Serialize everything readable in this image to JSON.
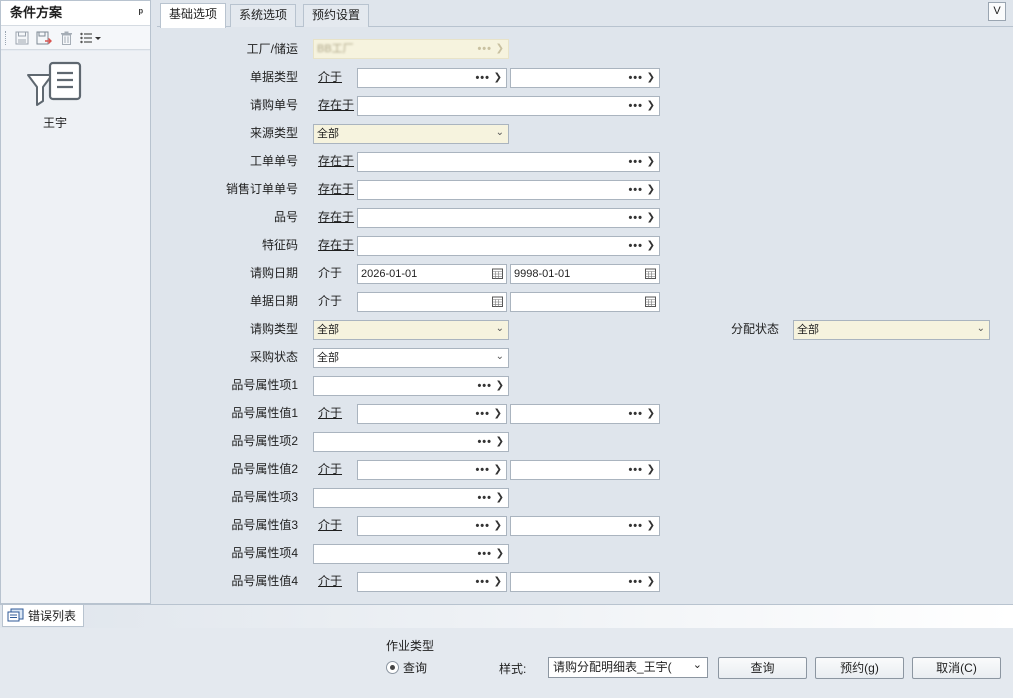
{
  "left_panel": {
    "title": "条件方案",
    "pin": "ᵖ",
    "scheme_name": "王宇"
  },
  "tabs": [
    "基础选项",
    "系统选项",
    "预约设置"
  ],
  "v_button": "V",
  "form": {
    "factory_label": "工厂/储运",
    "factory_value": "BB工厂",
    "rows": [
      {
        "label": "单据类型",
        "op": "介于"
      },
      {
        "label": "请购单号",
        "op": "存在于"
      },
      {
        "label": "来源类型",
        "value": "全部"
      },
      {
        "label": "工单单号",
        "op": "存在于"
      },
      {
        "label": "销售订单单号",
        "op": "存在于"
      },
      {
        "label": "品号",
        "op": "存在于"
      },
      {
        "label": "特征码",
        "op": "存在于"
      },
      {
        "label": "请购日期",
        "op": "介于",
        "value_from": "2026-01-01",
        "value_to": "9998-01-01"
      },
      {
        "label": "单据日期",
        "op": "介于"
      },
      {
        "label": "请购类型",
        "value": "全部"
      },
      {
        "label": "采购状态",
        "value": "全部"
      },
      {
        "label": "品号属性项1"
      },
      {
        "label": "品号属性值1",
        "op": "介于"
      },
      {
        "label": "品号属性项2"
      },
      {
        "label": "品号属性值2",
        "op": "介于"
      },
      {
        "label": "品号属性项3"
      },
      {
        "label": "品号属性值3",
        "op": "介于"
      },
      {
        "label": "品号属性项4"
      },
      {
        "label": "品号属性值4",
        "op": "介于"
      }
    ],
    "alloc_label": "分配状态",
    "alloc_value": "全部",
    "dots": "•••",
    "arrow": "❯",
    "drop": "⌄"
  },
  "error_tab": "错误列表",
  "bottom": {
    "op_type_title": "作业类型",
    "radio_query": "查询",
    "style_label": "样式:",
    "style_value": "请购分配明细表_王宇(",
    "query_btn": "查询",
    "reserve_btn": "预约(g)",
    "cancel_btn": "取消(C)"
  }
}
